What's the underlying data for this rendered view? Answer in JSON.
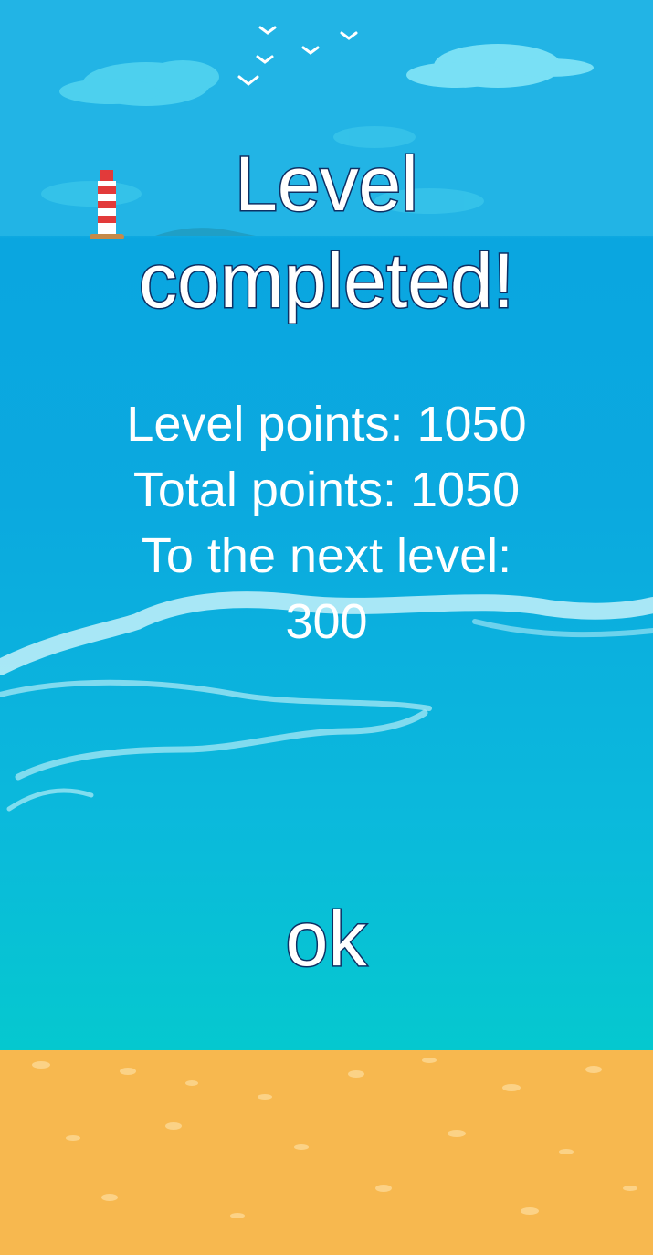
{
  "title": {
    "line1": "Level",
    "line2": "completed!"
  },
  "stats": {
    "level_points": "Level points: 1050",
    "total_points": "Total points: 1050",
    "next_level_label": "To the next level:",
    "next_level_value": "300"
  },
  "ok_button": {
    "label": "ok"
  },
  "colors": {
    "sky": "#22b6e6",
    "sea": "#0ba9df",
    "shore": "#05c9cc",
    "sand": "#f7b84f",
    "outline": "#0d2f63"
  }
}
